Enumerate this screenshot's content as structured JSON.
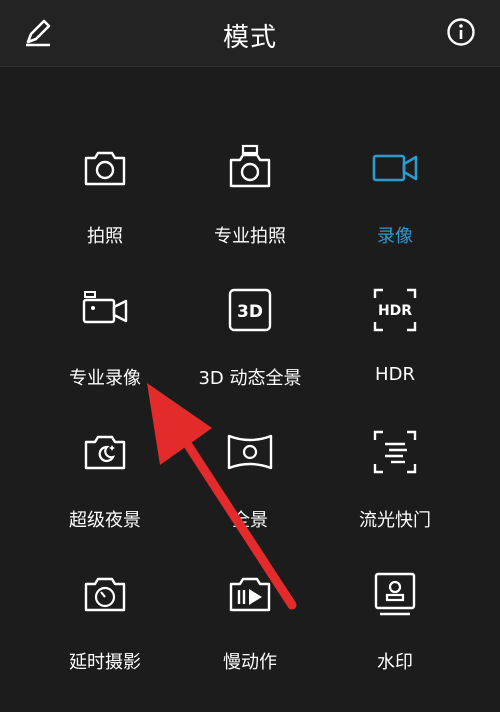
{
  "header": {
    "title": "模式"
  },
  "modes": [
    {
      "label": "拍照",
      "icon": "camera-icon",
      "active": false
    },
    {
      "label": "专业拍照",
      "icon": "pro-camera-icon",
      "active": false
    },
    {
      "label": "录像",
      "icon": "video-icon",
      "active": true
    },
    {
      "label": "专业录像",
      "icon": "pro-video-icon",
      "active": false
    },
    {
      "label": "3D 动态全景",
      "icon": "3d-icon",
      "active": false
    },
    {
      "label": "HDR",
      "icon": "hdr-icon",
      "active": false
    },
    {
      "label": "超级夜景",
      "icon": "night-icon",
      "active": false
    },
    {
      "label": "全景",
      "icon": "panorama-icon",
      "active": false
    },
    {
      "label": "流光快门",
      "icon": "light-painting-icon",
      "active": false
    },
    {
      "label": "延时摄影",
      "icon": "timelapse-icon",
      "active": false
    },
    {
      "label": "慢动作",
      "icon": "slow-motion-icon",
      "active": false
    },
    {
      "label": "水印",
      "icon": "watermark-icon",
      "active": false
    }
  ],
  "colors": {
    "accent": "#2b9bd0",
    "arrow": "#e32b2b",
    "background": "#1c1c1c"
  }
}
